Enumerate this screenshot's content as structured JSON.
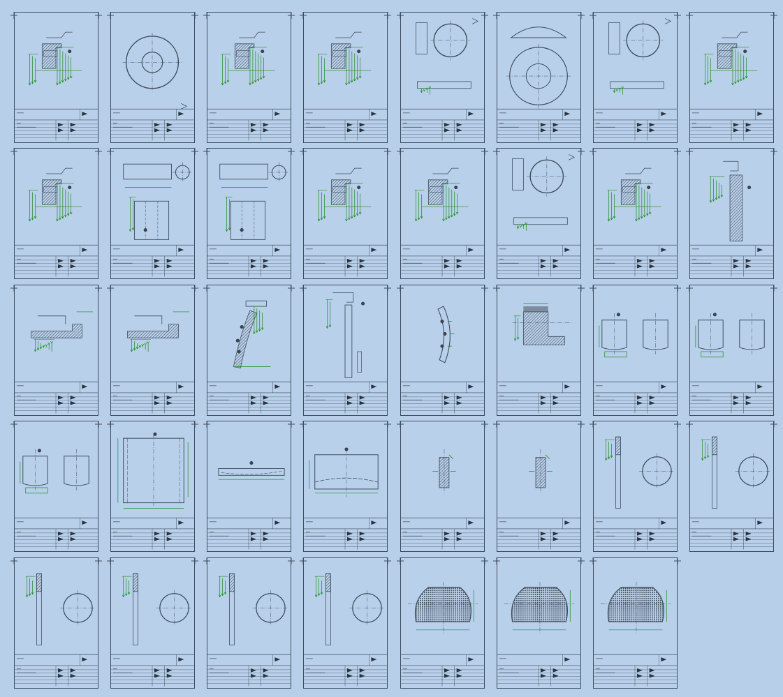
{
  "drawing_set": {
    "background_color": "#b8cfe9",
    "line_color": "#3e4d5e",
    "dimension_color": "#1a8a1a",
    "hatch_color": "#4a5560",
    "sheets": [
      {
        "icon": "flange-section"
      },
      {
        "icon": "ring-plan"
      },
      {
        "icon": "flange-section"
      },
      {
        "icon": "flange-section"
      },
      {
        "icon": "pipe-plan"
      },
      {
        "icon": "head-plan"
      },
      {
        "icon": "pipe-plan"
      },
      {
        "icon": "flange-section"
      },
      {
        "icon": "flange-section"
      },
      {
        "icon": "pipe-elevation"
      },
      {
        "icon": "pipe-elevation"
      },
      {
        "icon": "flange-section"
      },
      {
        "icon": "flange-section"
      },
      {
        "icon": "pipe-plan"
      },
      {
        "icon": "flange-section"
      },
      {
        "icon": "tall-section"
      },
      {
        "icon": "step-section"
      },
      {
        "icon": "step-section"
      },
      {
        "icon": "curved-section"
      },
      {
        "icon": "column-section"
      },
      {
        "icon": "arc-section"
      },
      {
        "icon": "block-section"
      },
      {
        "icon": "two-shells"
      },
      {
        "icon": "two-shells"
      },
      {
        "icon": "two-shells"
      },
      {
        "icon": "large-shell"
      },
      {
        "icon": "flat-plate"
      },
      {
        "icon": "shallow-head"
      },
      {
        "icon": "bar-section"
      },
      {
        "icon": "bar-section"
      },
      {
        "icon": "rod-and-ring"
      },
      {
        "icon": "rod-and-ring"
      },
      {
        "icon": "rod-and-ring"
      },
      {
        "icon": "rod-and-ring"
      },
      {
        "icon": "rod-and-ring"
      },
      {
        "icon": "rod-and-ring"
      },
      {
        "icon": "tube-sheet"
      },
      {
        "icon": "tube-sheet"
      },
      {
        "icon": "tube-sheet"
      }
    ]
  }
}
